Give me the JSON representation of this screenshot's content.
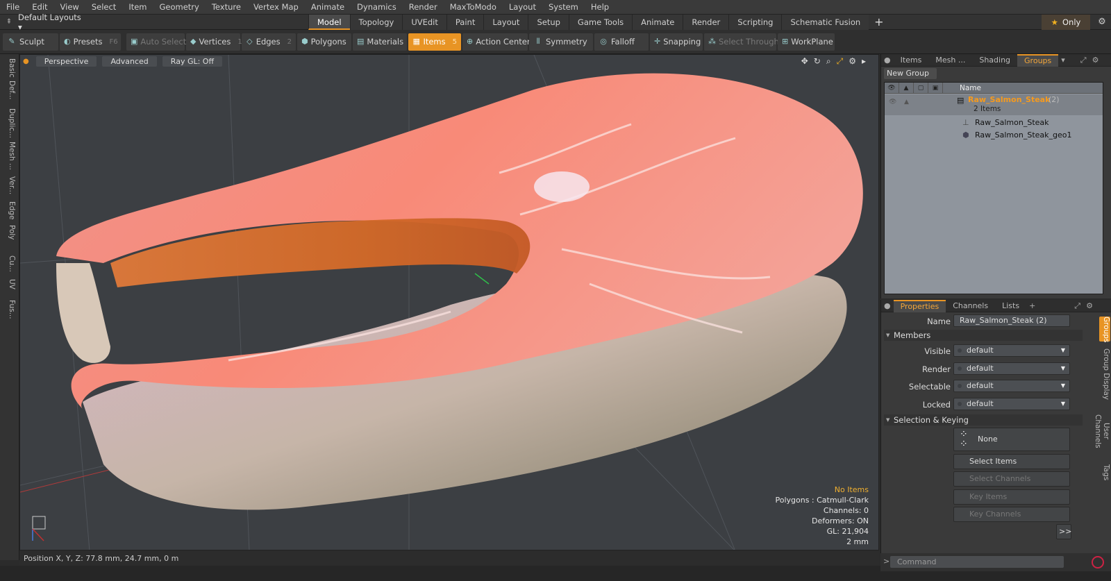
{
  "menu": [
    "File",
    "Edit",
    "View",
    "Select",
    "Item",
    "Geometry",
    "Texture",
    "Vertex Map",
    "Animate",
    "Dynamics",
    "Render",
    "MaxToModo",
    "Layout",
    "System",
    "Help"
  ],
  "layout_dropdown": "Default Layouts",
  "layout_tabs": [
    "Model",
    "Topology",
    "UVEdit",
    "Paint",
    "Layout",
    "Setup",
    "Game Tools",
    "Animate",
    "Render",
    "Scripting",
    "Schematic Fusion"
  ],
  "layout_active": "Model",
  "only_label": "Only",
  "toolbar": {
    "sculpt": "Sculpt",
    "presets": "Presets",
    "presets_key": "F6",
    "auto_select": "Auto Select",
    "vertices": "Vertices",
    "vertices_key": "1",
    "edges": "Edges",
    "edges_key": "2",
    "polygons": "Polygons",
    "polygons_key": "3",
    "materials": "Materials",
    "items": "Items",
    "items_key": "5",
    "action_center": "Action Center",
    "symmetry": "Symmetry",
    "falloff": "Falloff",
    "snapping": "Snapping",
    "select_through": "Select Through",
    "workplane": "WorkPlane"
  },
  "left_tabs": [
    "Basic",
    "Def...",
    "Duplic...",
    "Mesh ...",
    "Ver...",
    "Edge",
    "Poly",
    "Cu...",
    "UV",
    "Fus..."
  ],
  "viewport": {
    "view": "Perspective",
    "shading": "Advanced",
    "raygl": "Ray GL: Off",
    "info": {
      "no_items": "No Items",
      "polygons": "Polygons : Catmull-Clark",
      "channels": "Channels: 0",
      "deformers": "Deformers: ON",
      "gl": "GL: 21,904",
      "scale": "2 mm"
    }
  },
  "status": "Position X, Y, Z:   77.8 mm, 24.7 mm, 0 m",
  "groups_panel": {
    "tabs": [
      "Items",
      "Mesh ...",
      "Shading",
      "Groups"
    ],
    "active_tab": "Groups",
    "new_group": "New Group",
    "name_header": "Name",
    "group_name": "Raw_Salmon_Steak",
    "group_count": "(2)",
    "group_items": "2 Items",
    "children": [
      "Raw_Salmon_Steak",
      "Raw_Salmon_Steak_geo1"
    ]
  },
  "properties_panel": {
    "tabs": [
      "Properties",
      "Channels",
      "Lists"
    ],
    "active_tab": "Properties",
    "name_label": "Name",
    "name_value": "Raw_Salmon_Steak (2)",
    "members_section": "Members",
    "fields": [
      {
        "label": "Visible",
        "value": "default"
      },
      {
        "label": "Render",
        "value": "default"
      },
      {
        "label": "Selectable",
        "value": "default"
      },
      {
        "label": "Locked",
        "value": "default"
      }
    ],
    "keying_section": "Selection & Keying",
    "none_label": "None",
    "buttons": [
      "Select Items",
      "Select Channels",
      "Key Items",
      "Key Channels"
    ],
    "more": ">>",
    "side_tabs": [
      "Groups",
      "Group Display",
      "User Channels",
      "Tags"
    ]
  },
  "command_placeholder": "Command"
}
